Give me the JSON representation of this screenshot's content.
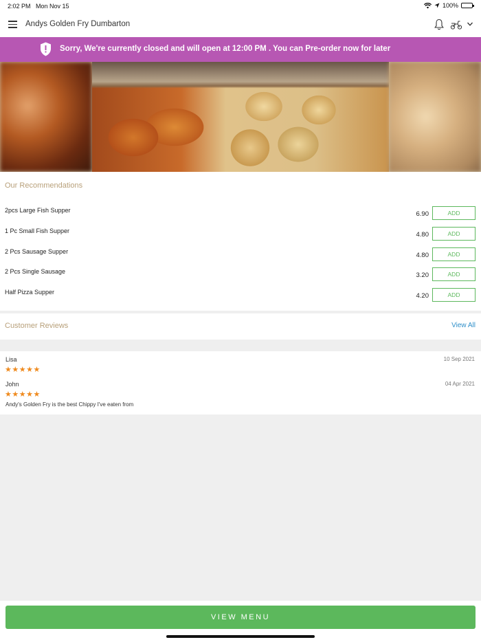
{
  "status": {
    "time": "2:02 PM",
    "date": "Mon Nov 15",
    "battery": "100%"
  },
  "header": {
    "title": "Andys Golden Fry Dumbarton"
  },
  "banner": {
    "message": "Sorry, We're currently closed and will open at 12:00 PM . You can Pre-order now for later",
    "color": "#b757b3"
  },
  "recommendations": {
    "title": "Our Recommendations",
    "add_label": "ADD",
    "items": [
      {
        "name": "2pcs Large Fish Supper",
        "price": "6.90"
      },
      {
        "name": "1 Pc Small Fish Supper",
        "price": "4.80"
      },
      {
        "name": "2 Pcs Sausage Supper",
        "price": "4.80"
      },
      {
        "name": "2 Pcs Single Sausage",
        "price": "3.20"
      },
      {
        "name": "Half Pizza Supper",
        "price": "4.20"
      }
    ]
  },
  "reviews": {
    "title": "Customer Reviews",
    "view_all": "View All",
    "items": [
      {
        "name": "Lisa",
        "date": "10 Sep 2021",
        "rating": 5,
        "stars": "★★★★★",
        "text": ""
      },
      {
        "name": "John",
        "date": "04 Apr 2021",
        "rating": 5,
        "stars": "★★★★★",
        "text": "Andy's Golden Fry is the best Chippy I've eaten from"
      }
    ]
  },
  "footer": {
    "button_label": "VIEW MENU",
    "accent": "#5cb85c"
  }
}
